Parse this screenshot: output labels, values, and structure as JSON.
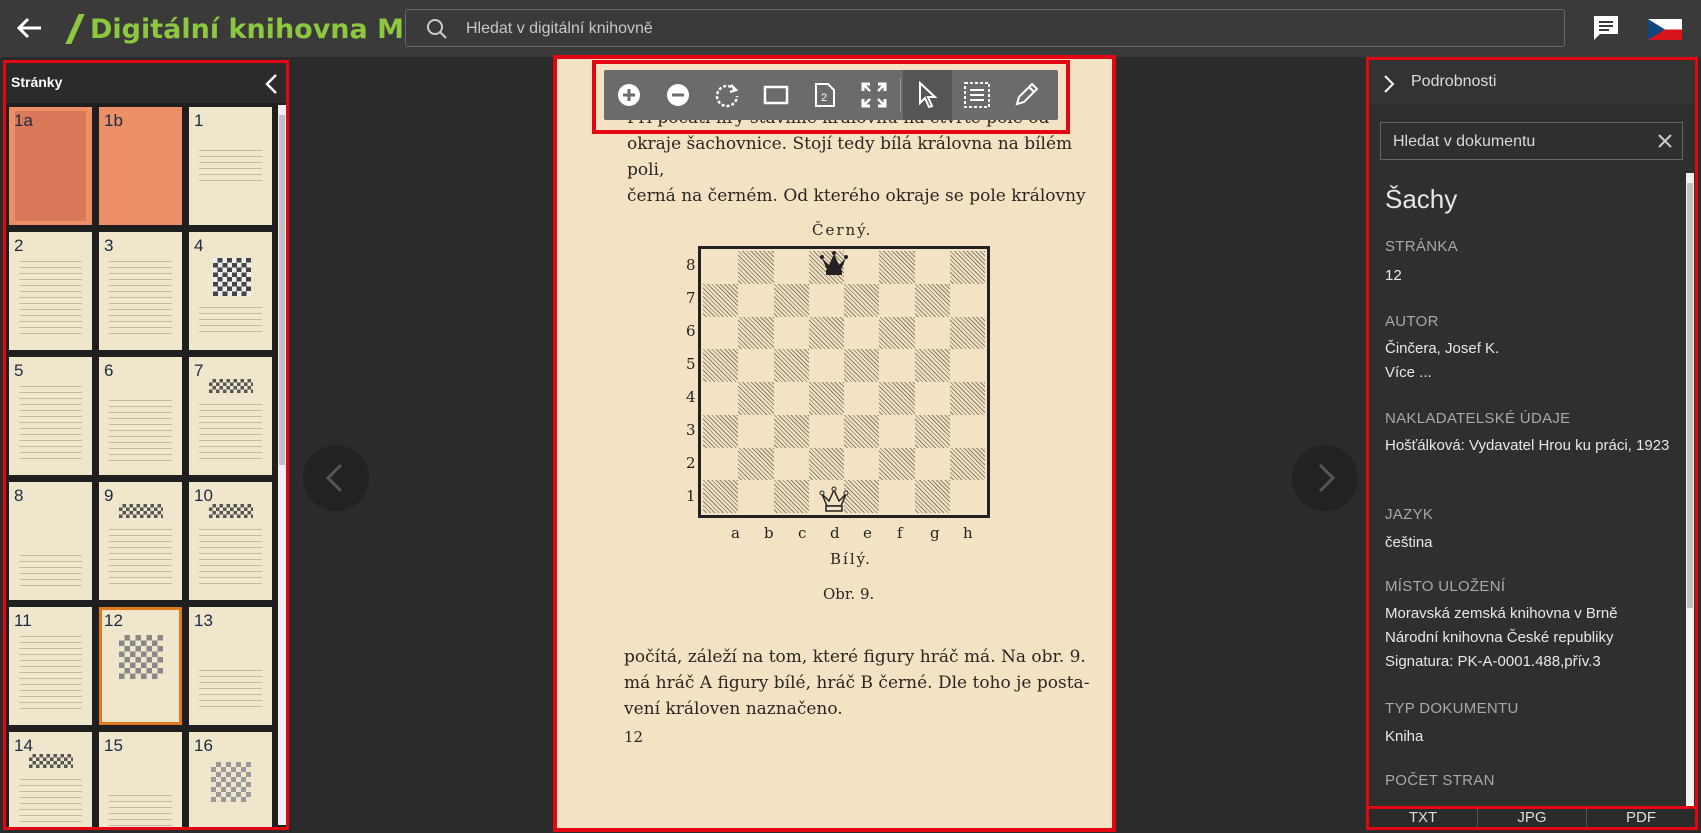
{
  "header": {
    "logo_text": "Digitální knihovna MZK",
    "search_placeholder": "Hledat v digitální knihovně"
  },
  "pages_panel": {
    "title": "Stránky",
    "thumbnails": [
      {
        "label": "1a"
      },
      {
        "label": "1b"
      },
      {
        "label": "1"
      },
      {
        "label": "2"
      },
      {
        "label": "3"
      },
      {
        "label": "4"
      },
      {
        "label": "5"
      },
      {
        "label": "6"
      },
      {
        "label": "7"
      },
      {
        "label": "8"
      },
      {
        "label": "9"
      },
      {
        "label": "10"
      },
      {
        "label": "11"
      },
      {
        "label": "12"
      },
      {
        "label": "13"
      },
      {
        "label": "14"
      },
      {
        "label": "15"
      },
      {
        "label": "16"
      }
    ],
    "selected": "12"
  },
  "page": {
    "top_lines": [
      "Při počátí hry stavíme královnu na čtvrté pole od",
      "okraje šachovnice. Stojí tedy bílá královna na bílém poli,",
      "černá na černém. Od kterého okraje se pole královny"
    ],
    "black_label": "Černý.",
    "white_label": "Bílý.",
    "figure_label": "Obr. 9.",
    "ranks": [
      "8",
      "7",
      "6",
      "5",
      "4",
      "3",
      "2",
      "1"
    ],
    "files": [
      "a",
      "b",
      "c",
      "d",
      "e",
      "f",
      "g",
      "h"
    ],
    "bottom_lines": [
      "počítá, záleží na tom, které figury hráč má. Na obr. 9.",
      "má hráč A figury bílé, hráč B černé. Dle toho je posta-",
      "vení královen naznačeno."
    ],
    "page_number": "12"
  },
  "details_panel": {
    "header_label": "Podrobnosti",
    "search_placeholder": "Hledat v dokumentu",
    "title": "Šachy",
    "fields": {
      "page_label": "STRÁNKA",
      "page_value": "12",
      "author_label": "AUTOR",
      "author_value": "Činčera, Josef K.",
      "author_more": "Více ...",
      "publisher_label": "NAKLADATELSKÉ ÚDAJE",
      "publisher_value": "Hošťálková: Vydavatel Hrou ku práci, 1923",
      "language_label": "JAZYK",
      "language_value": "čeština",
      "location_label": "MÍSTO ULOŽENÍ",
      "location_1": "Moravská zemská knihovna v Brně",
      "location_2": "Národní knihovna České republiky",
      "location_3": "Signatura: PK-A-0001.488,přív.3",
      "doctype_label": "TYP DOKUMENTU",
      "doctype_value": "Kniha",
      "pages_label": "POČET STRAN"
    }
  },
  "downloads": {
    "txt": "TXT",
    "jpg": "JPG",
    "pdf": "PDF"
  },
  "colors": {
    "accent_green": "#8dc63f",
    "highlight_red": "#e30613",
    "selected_thumb": "#e07a1c"
  }
}
